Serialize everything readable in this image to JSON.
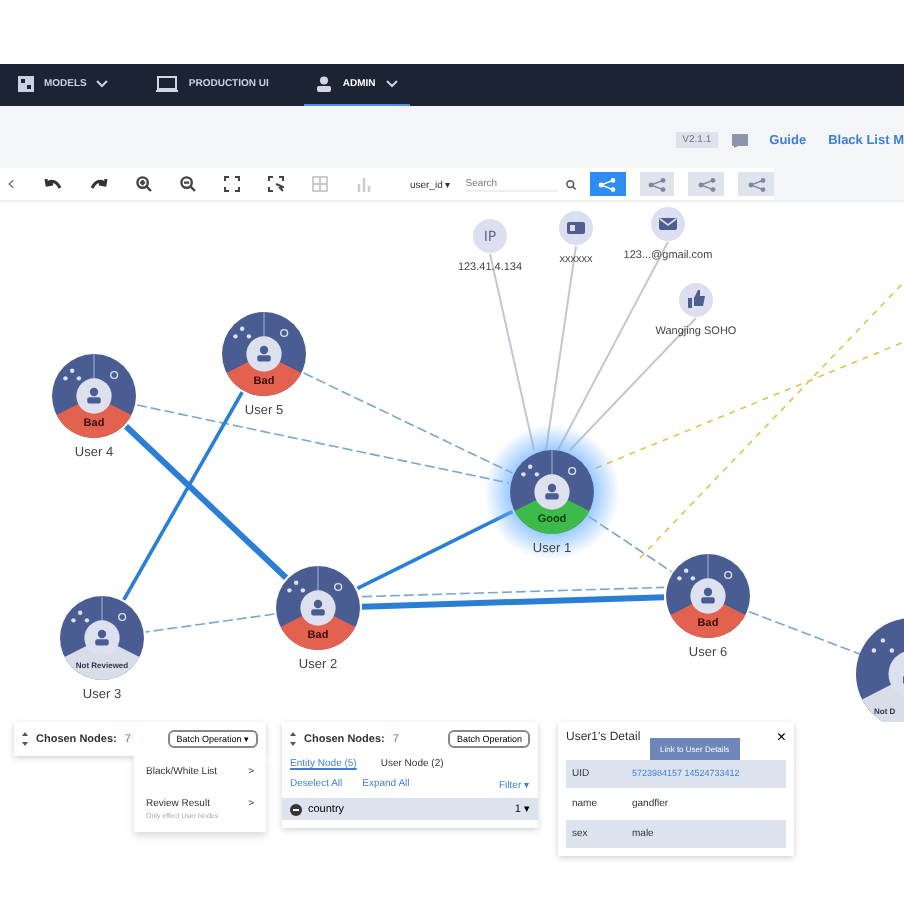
{
  "nav": {
    "tabs": [
      {
        "label": "MODELS",
        "selected": false
      },
      {
        "label": "PRODUCTION UI",
        "selected": false
      },
      {
        "label": "ADMIN",
        "selected": true
      }
    ]
  },
  "header": {
    "version": "V2.1.1",
    "links": [
      "Guide",
      "Black List M"
    ]
  },
  "toolbar": {
    "search_field": "user_id ▾",
    "search": {
      "placeholder": "Search"
    },
    "view_buttons": [
      {
        "selected": true
      },
      {
        "selected": false
      },
      {
        "selected": false
      },
      {
        "selected": false
      }
    ]
  },
  "graph": {
    "users": [
      {
        "name": "User 4",
        "status": "Bad",
        "kind": "bad",
        "highlighted": false
      },
      {
        "name": "User 5",
        "status": "Bad",
        "kind": "bad",
        "highlighted": false
      },
      {
        "name": "User 1",
        "status": "Good",
        "kind": "good",
        "highlighted": true
      },
      {
        "name": "User 2",
        "status": "Bad",
        "kind": "bad",
        "highlighted": false
      },
      {
        "name": "User 3",
        "status": "Not Reviewed",
        "kind": "not_reviewed",
        "highlighted": false
      },
      {
        "name": "User 6",
        "status": "Bad",
        "kind": "bad",
        "highlighted": false
      },
      {
        "status": "Not D",
        "kind": "not_reviewed",
        "highlighted": false
      }
    ],
    "entities": [
      {
        "label": "123.41.4.134",
        "kind": "ip",
        "badge": "IP"
      },
      {
        "label": "xxxxxx",
        "kind": "id"
      },
      {
        "label": "123...@gmail.com",
        "kind": "email"
      },
      {
        "label": "Wangjing SOHO",
        "kind": "address"
      }
    ]
  },
  "panels": [
    {
      "title": "Chosen Nodes:",
      "count": "7",
      "button": "Batch Operation ▾",
      "menu": [
        {
          "label": "Black/White List",
          "arrow": ">"
        },
        {
          "label": "Review Result",
          "arrow": ">",
          "hint": "Only effect User Nodes"
        }
      ]
    },
    {
      "title": "Chosen Nodes:",
      "count": "7",
      "button": "Batch Operation",
      "tabs": [
        {
          "label": "Entity Node (5)",
          "selected": true
        },
        {
          "label": "User Node (2)",
          "selected": false
        }
      ],
      "actions": [
        "Deselect All",
        "Expand All"
      ],
      "filter": "Filter ▾",
      "row": {
        "label": "country",
        "value": "1 ▾"
      }
    }
  ],
  "detail": {
    "title": "User1's Detail",
    "close": "×",
    "tooltip": "Link to User Details",
    "rows": [
      {
        "key": "UID",
        "value": "5723984157 14524733412",
        "link": true
      },
      {
        "key": "name",
        "value": "gandfler",
        "link": false
      },
      {
        "key": "sex",
        "value": "male",
        "link": false
      }
    ]
  }
}
